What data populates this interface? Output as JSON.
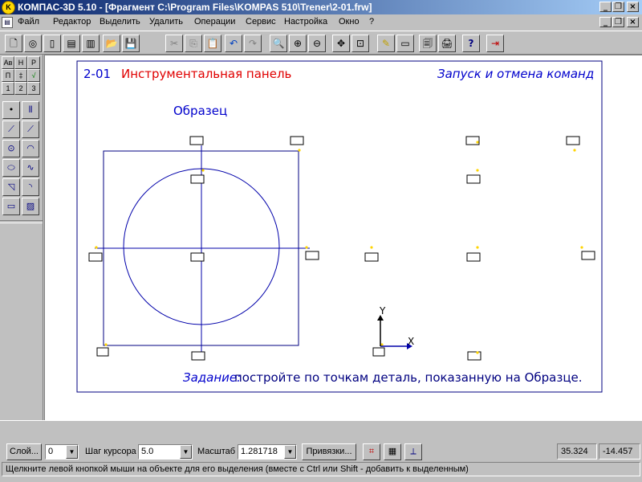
{
  "window": {
    "title": "КОМПАС-3D 5.10 - [Фрагмент C:\\Program Files\\KOMPAS 510\\Trener\\2-01.frw]",
    "app_icon": "kompas-logo-icon"
  },
  "menu": {
    "items": [
      "Файл",
      "Редактор",
      "Выделить",
      "Удалить",
      "Операции",
      "Сервис",
      "Настройка",
      "Окно",
      "?"
    ]
  },
  "toolbar": {
    "icons": [
      "new-doc-icon",
      "new-drawing-icon",
      "new-fragment-icon",
      "new-spec-icon",
      "new-text-icon",
      "open-folder-icon",
      "save-icon",
      "cut-icon",
      "copy-icon",
      "paste-icon",
      "undo-icon",
      "redo-icon",
      "zoom-icon",
      "zoom-in-icon",
      "zoom-out-icon",
      "pan-icon",
      "zoom-window-icon",
      "redraw-icon",
      "layer-icon",
      "preview-icon",
      "print-icon",
      "help-cursor-icon",
      "exit-icon"
    ]
  },
  "left_toolbar": {
    "mode_tabs": [
      "Ав",
      "Н",
      "Р",
      "П",
      "‡",
      "√",
      "1",
      "2",
      "3"
    ],
    "tools": [
      "point-icon",
      "aux-line-icon",
      "segment-icon",
      "parallel-segment-icon",
      "circle-icon",
      "arc-icon",
      "ellipse-icon",
      "spline-icon",
      "chamfer-icon",
      "fillet-icon",
      "rectangle-icon",
      "hatch-icon"
    ]
  },
  "canvas": {
    "lesson_number": "2-01",
    "lesson_title": "Инструментальная панель",
    "lesson_topic": "Запуск и отмена команд",
    "sample_label": "Образец",
    "task_label": "Задание:",
    "task_text": "постройте по точкам деталь, показанную на Образце.",
    "axis_x": "X",
    "axis_y": "Y",
    "colors": {
      "border": "#000080",
      "blue_text": "#0000cc",
      "red_text": "#e00000",
      "point": "#ffd400",
      "figure": "#0000aa"
    }
  },
  "status": {
    "layer_btn": "Слой...",
    "layer_value": "0",
    "step_label": "Шаг курсора",
    "step_value": "5.0",
    "scale_label": "Масштаб",
    "scale_value": "1.281718",
    "snap_btn": "Привязки...",
    "coord_x": "35.324",
    "coord_y": "-14.457",
    "message": "Щелкните левой кнопкой мыши на объекте для его выделения (вместе с Ctrl или Shift - добавить к выделенным)"
  }
}
